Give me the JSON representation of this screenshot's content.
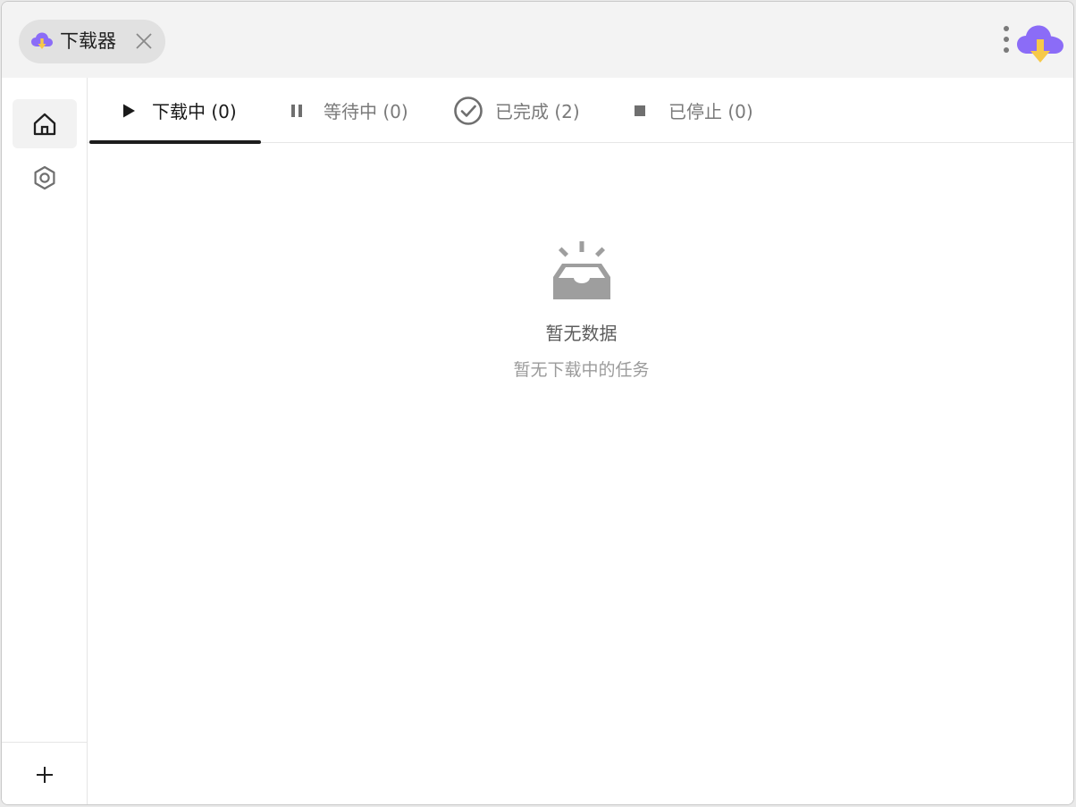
{
  "titlebar": {
    "tab_title": "下载器",
    "icons": {
      "tab_icon": "cloud-download-icon",
      "close": "close-icon",
      "more": "more-vertical-icon",
      "logo": "cloud-download-logo-icon"
    }
  },
  "sidebar": {
    "items": [
      {
        "name": "home",
        "icon": "home-icon",
        "active": true
      },
      {
        "name": "settings",
        "icon": "settings-hexagon-icon",
        "active": false
      }
    ],
    "bottom": {
      "icon": "plus-icon"
    }
  },
  "tabs": [
    {
      "label": "下载中 (0)",
      "icon": "play-icon",
      "active": true
    },
    {
      "label": "等待中 (0)",
      "icon": "pause-icon",
      "active": false
    },
    {
      "label": "已完成 (2)",
      "icon": "check-circle-icon",
      "active": false
    },
    {
      "label": "已停止 (0)",
      "icon": "stop-icon",
      "active": false
    }
  ],
  "empty_state": {
    "icon": "empty-inbox-icon",
    "title": "暂无数据",
    "description": "暂无下载中的任务"
  },
  "colors": {
    "accent_purple": "#8b6cf7",
    "accent_yellow": "#f7c948",
    "active_tab": "#1c1c1c",
    "muted_text": "#7a7a7a"
  }
}
